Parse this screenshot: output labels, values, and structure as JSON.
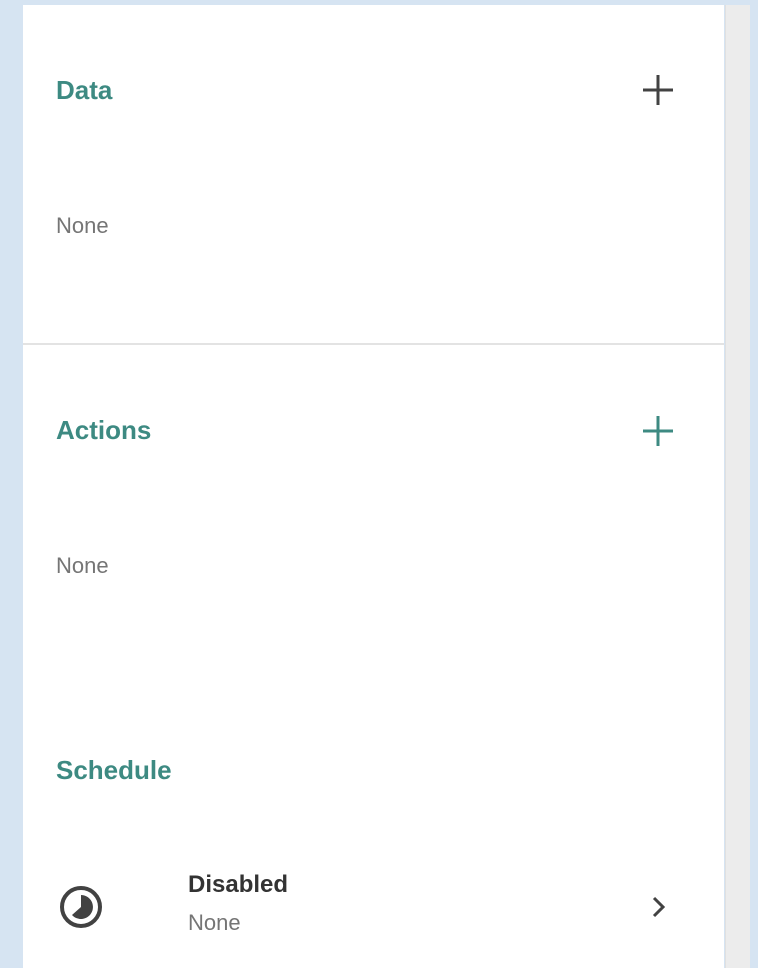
{
  "sections": {
    "data": {
      "title": "Data",
      "empty_text": "None"
    },
    "actions": {
      "title": "Actions",
      "empty_text": "None"
    },
    "schedule": {
      "title": "Schedule",
      "status_label": "Disabled",
      "status_detail": "None"
    }
  },
  "icons": {
    "add_data": "plus-icon",
    "add_actions": "plus-icon",
    "schedule": "clock-icon",
    "schedule_open": "chevron-right-icon"
  },
  "colors": {
    "accent": "#3d8a82",
    "background": "#d6e4f2",
    "panel": "#ffffff",
    "muted_text": "#757575",
    "dark_icon": "#424242"
  }
}
